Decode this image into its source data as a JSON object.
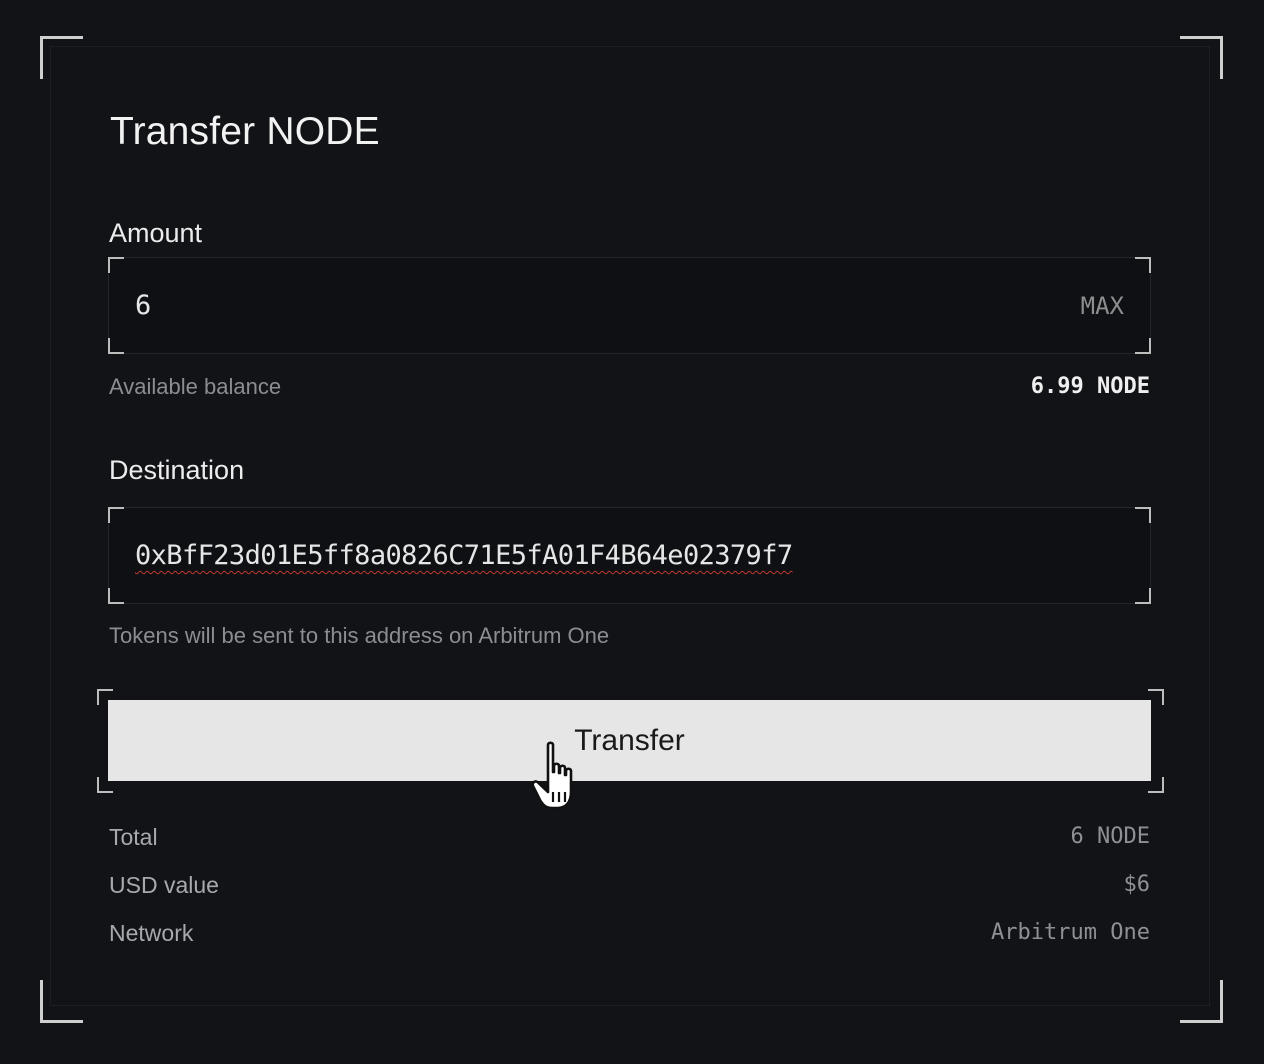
{
  "dialog": {
    "title": "Transfer NODE"
  },
  "amount": {
    "label": "Amount",
    "value": "6",
    "max_label": "MAX",
    "balance_label": "Available balance",
    "balance_value": "6.99 NODE"
  },
  "destination": {
    "label": "Destination",
    "value": "0xBfF23d01E5ff8a0826C71E5fA01F4B64e02379f7",
    "helper": "Tokens will be sent to this address on Arbitrum One"
  },
  "actions": {
    "transfer_label": "Transfer"
  },
  "summary": {
    "total_label": "Total",
    "total_value": "6 NODE",
    "usd_label": "USD value",
    "usd_value": "$6",
    "network_label": "Network",
    "network_value": "Arbitrum One"
  },
  "icons": {
    "cursor": "hand-pointer-icon"
  }
}
